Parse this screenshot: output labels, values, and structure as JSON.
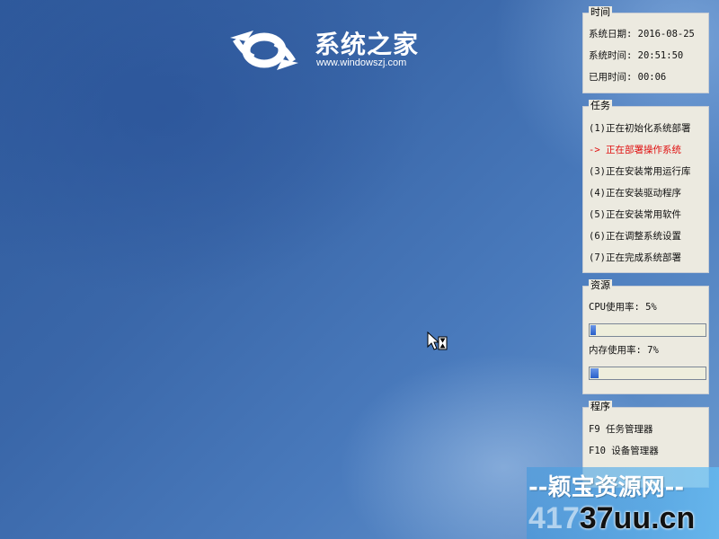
{
  "logo": {
    "brand": "系统之家",
    "url": "www.windowszj.com"
  },
  "time_panel": {
    "title": "时间",
    "rows": [
      "系统日期: 2016-08-25",
      "系统时间: 20:51:50",
      "已用时间: 00:06"
    ]
  },
  "task_panel": {
    "title": "任务",
    "items": [
      {
        "text": "(1)正在初始化系统部署",
        "active": false
      },
      {
        "text": "-> 正在部署操作系统",
        "active": true
      },
      {
        "text": "(3)正在安装常用运行库",
        "active": false
      },
      {
        "text": "(4)正在安装驱动程序",
        "active": false
      },
      {
        "text": "(5)正在安装常用软件",
        "active": false
      },
      {
        "text": "(6)正在调整系统设置",
        "active": false
      },
      {
        "text": "(7)正在完成系统部署",
        "active": false
      }
    ]
  },
  "resource_panel": {
    "title": "资源",
    "cpu_label": "CPU使用率: 5%",
    "cpu_percent": 5,
    "mem_label": "内存使用率: 7%",
    "mem_percent": 7
  },
  "program_panel": {
    "title": "程序",
    "items": [
      "F9  任务管理器",
      "F10 设备管理器"
    ]
  },
  "watermark": {
    "line1": "--颖宝资源网--",
    "line2_faded": "417",
    "line2": "37uu.cn"
  },
  "colors": {
    "active_task": "#e01010",
    "progress_fill": "#2a60c9"
  }
}
